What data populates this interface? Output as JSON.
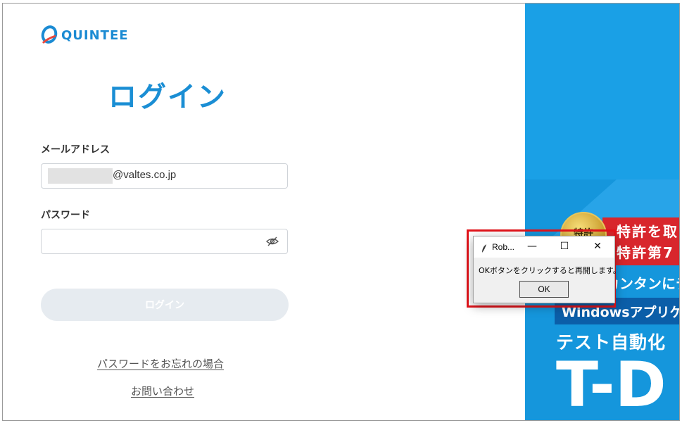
{
  "brand": {
    "name": "QUINTEE",
    "color": "#1b8bd3"
  },
  "page": {
    "title": "ログイン"
  },
  "form": {
    "email_label": "メールアドレス",
    "email_value": "@valtes.co.jp",
    "password_label": "パスワード",
    "password_value": "",
    "login_button": "ログイン"
  },
  "links": {
    "forgot_password": "パスワードをお忘れの場合",
    "contact": "お問い合わせ"
  },
  "banner": {
    "seal": "特許",
    "line1": "特許を取",
    "line2": "特許第7",
    "line3": "カンタンにテ",
    "line4": "Windowsアプリケ",
    "line5": "テスト自動化",
    "line6": "T-D"
  },
  "dialog": {
    "title": "Rob...",
    "message": "OKボタンをクリックすると再開します。",
    "ok_label": "OK",
    "minimize": "—",
    "maximize": "☐",
    "close": "✕"
  },
  "colors": {
    "accent": "#1a8ed4",
    "banner": "#1596dc",
    "highlight": "#e3141b"
  }
}
